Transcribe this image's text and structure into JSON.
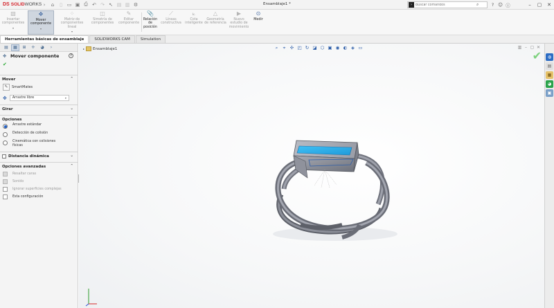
{
  "app": {
    "logo_ds": "DS",
    "logo_solid": "SOLID",
    "logo_works": "WORKS",
    "document_title": "Ensamblaje1 *"
  },
  "search": {
    "placeholder": "Buscar comandos"
  },
  "ribbon": {
    "buttons": [
      {
        "label": "Insertar componentes",
        "icon": "insert-component-icon",
        "state": "disabled"
      },
      {
        "label": "Mover componente",
        "icon": "move-component-icon",
        "state": "selected"
      },
      {
        "label": "Matriz de componentes lineal",
        "icon": "linear-pattern-icon",
        "state": "disabled"
      },
      {
        "label": "Simetría de componentes",
        "icon": "mirror-components-icon",
        "state": "disabled"
      },
      {
        "label": "Editar componente",
        "icon": "edit-component-icon",
        "state": "disabled"
      },
      {
        "label": "Relación de posición",
        "icon": "mate-icon",
        "state": "active"
      },
      {
        "label": "Líneas constructiva",
        "icon": "construction-lines-icon",
        "state": "disabled"
      },
      {
        "label": "Cota inteligente",
        "icon": "smart-dimension-icon",
        "state": "disabled"
      },
      {
        "label": "Geometría de referencia",
        "icon": "reference-geometry-icon",
        "state": "disabled"
      },
      {
        "label": "Nuevo estudio de movimiento",
        "icon": "motion-study-icon",
        "state": "disabled"
      },
      {
        "label": "Medir",
        "icon": "measure-icon",
        "state": "active"
      }
    ]
  },
  "tabs": [
    {
      "label": "Herramientas básicas de ensamblaje",
      "active": true
    },
    {
      "label": "SOLIDWORKS CAM",
      "active": false
    },
    {
      "label": "Simulation",
      "active": false
    }
  ],
  "property_manager": {
    "title": "Mover componente",
    "sections": {
      "mover": {
        "header": "Mover",
        "smartmates_label": "SmartMates",
        "drag_mode": "Arrastre libre"
      },
      "girar": {
        "header": "Girar"
      },
      "opciones": {
        "header": "Opciones",
        "radio_standard": "Arrastre estándar",
        "radio_collision": "Detección de colisión",
        "radio_physics_line1": "Cinemática con colisiones",
        "radio_physics_line2": "físicas"
      },
      "distancia": {
        "header": "Distancia dinámica"
      },
      "avanzadas": {
        "header": "Opciones avanzadas",
        "highlight_faces": "Resaltar caras",
        "sound": "Sonido",
        "ignore_complex": "Ignorar superficies complejas",
        "this_config": "Esta configuración"
      }
    }
  },
  "viewport": {
    "tree_label": "Ensamblaje1"
  },
  "colors": {
    "accent_blue": "#2c5da8",
    "model_gray": "#8a8d96",
    "screen_cyan": "#2aa8e8",
    "ok_green": "#23a52c",
    "brand_red": "#d4232a"
  }
}
